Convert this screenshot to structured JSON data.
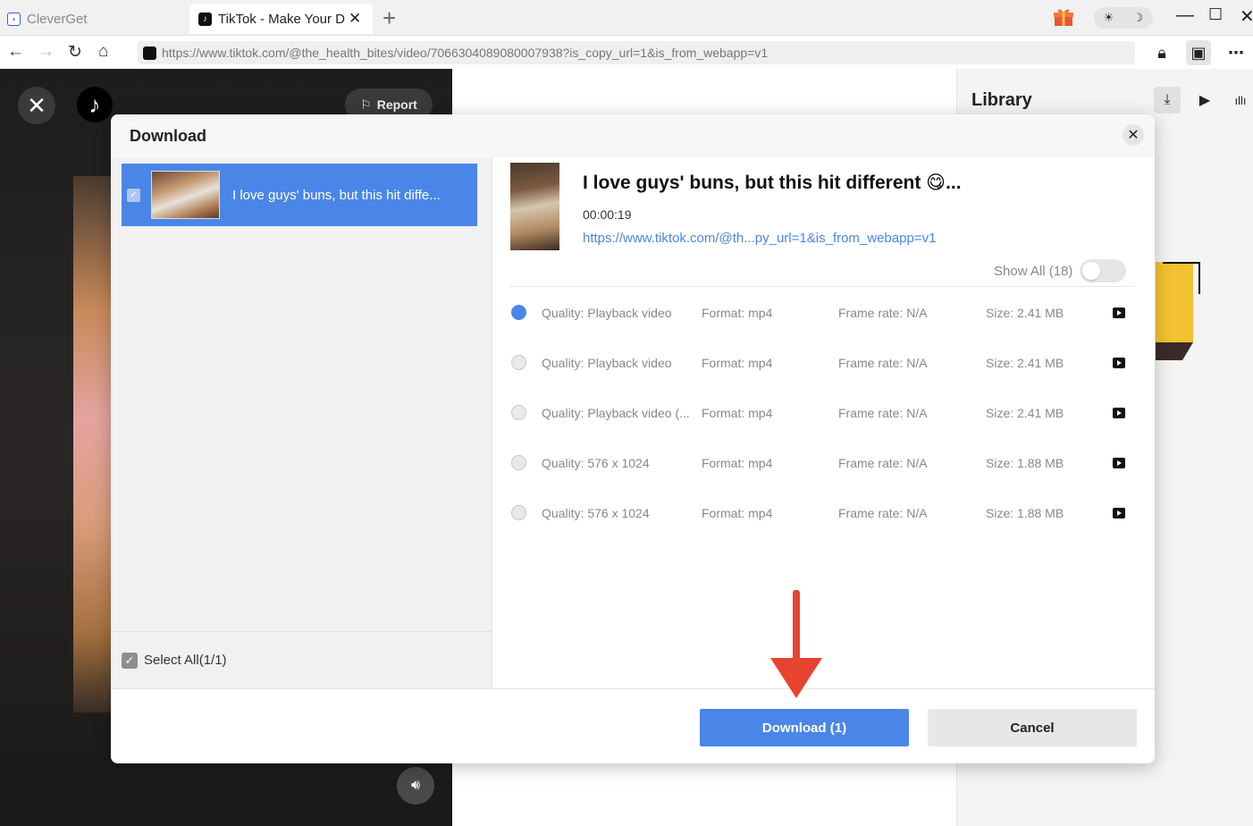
{
  "browser": {
    "tabs": [
      {
        "label": "CleverGet",
        "active": false
      },
      {
        "label": "TikTok - Make Your D",
        "active": true
      }
    ],
    "close_tab": "✕",
    "new_tab": "+",
    "url": "https://www.tiktok.com/@the_health_bites/video/7066304089080007938?is_copy_url=1&is_from_webapp=v1",
    "window_controls": {
      "minimize": "—",
      "maximize": "☐",
      "close": "✕"
    }
  },
  "tiktok": {
    "report_label": "Report"
  },
  "library": {
    "title": "Library"
  },
  "modal": {
    "title": "Download",
    "close": "✕",
    "video_list": [
      {
        "title": "I love guys' buns, but this hit diffe...",
        "checked": true
      }
    ],
    "select_all": "Select All(1/1)",
    "detail": {
      "title": "I love guys' buns, but this hit different 😋...",
      "duration": "00:00:19",
      "url": "https://www.tiktok.com/@th...py_url=1&is_from_webapp=v1",
      "show_all": "Show All (18)"
    },
    "options": [
      {
        "quality": "Quality: Playback video",
        "format": "Format: mp4",
        "frame_rate": "Frame rate: N/A",
        "size": "Size: 2.41 MB",
        "selected": true
      },
      {
        "quality": "Quality: Playback video",
        "format": "Format: mp4",
        "frame_rate": "Frame rate: N/A",
        "size": "Size: 2.41 MB",
        "selected": false
      },
      {
        "quality": "Quality: Playback video (...",
        "format": "Format: mp4",
        "frame_rate": "Frame rate: N/A",
        "size": "Size: 2.41 MB",
        "selected": false
      },
      {
        "quality": "Quality: 576 x 1024",
        "format": "Format: mp4",
        "frame_rate": "Frame rate: N/A",
        "size": "Size: 1.88 MB",
        "selected": false
      },
      {
        "quality": "Quality: 576 x 1024",
        "format": "Format: mp4",
        "frame_rate": "Frame rate: N/A",
        "size": "Size: 1.88 MB",
        "selected": false
      }
    ],
    "download_button": "Download (1)",
    "cancel_button": "Cancel"
  },
  "colors": {
    "accent": "#4a86e8",
    "arrow": "#e8432e"
  }
}
